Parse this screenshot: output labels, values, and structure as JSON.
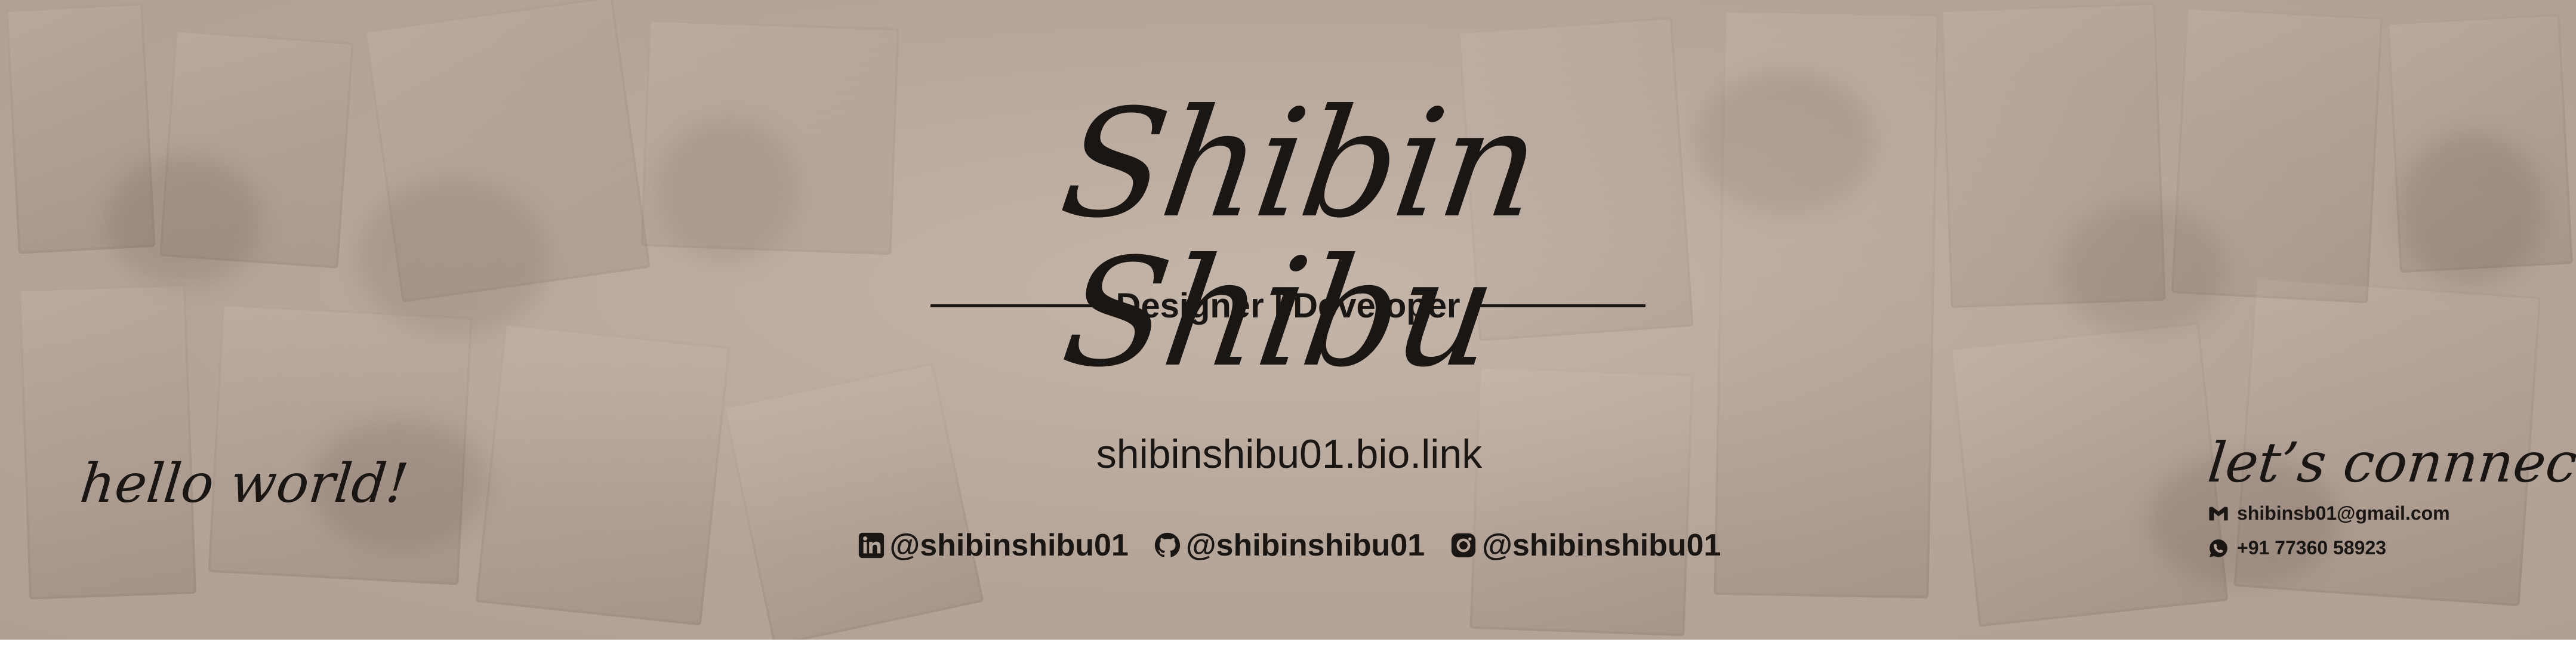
{
  "banner": {
    "name": "Shibin Shibu",
    "role": "Designer | Developer",
    "bio_link": "shibinshibu01.bio.link",
    "greeting": "hello world!",
    "connect_heading": "let’s connnect!"
  },
  "socials": [
    {
      "icon": "linkedin-icon",
      "handle": "@shibinshibu01"
    },
    {
      "icon": "github-icon",
      "handle": "@shibinshibu01"
    },
    {
      "icon": "instagram-icon",
      "handle": "@shibinshibu01"
    }
  ],
  "contacts": {
    "email": {
      "icon": "gmail-icon",
      "text": "shibinsb01@gmail.com"
    },
    "phone": {
      "icon": "whatsapp-icon",
      "text": "+91 77360 58923"
    }
  },
  "colors": {
    "background": "#b5a498",
    "text": "#1a1614"
  }
}
